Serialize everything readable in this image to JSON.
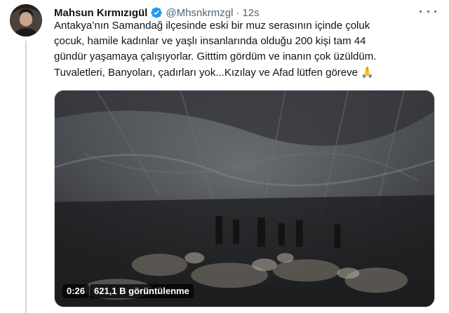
{
  "author": {
    "name": "Mahsun Kırmızıgül",
    "handle": "@Mhsnkrmzgl",
    "separator": "·",
    "time": "12s",
    "verified_color": "#1d9bf0"
  },
  "tweet": {
    "text": "Antakya’nın Samandağ ilçesinde eski  bir muz serasının içinde çoluk\nçocuk, hamile kadınlar ve yaşlı insanlarında olduğu 200  kişi  tam 44\ngündür yaşamaya çalışıyorlar. Gitttim gördüm ve inanın çok üzüldüm.\nTuvaletleri, Banyoları, çadırları yok...Kızılay ve Afad lütfen göreve 🙏"
  },
  "media": {
    "type": "video",
    "duration": "0:26",
    "views": "621,1 B görüntülenme"
  },
  "icons": {
    "verified": "verified-badge-icon",
    "more": "more-options-icon"
  }
}
